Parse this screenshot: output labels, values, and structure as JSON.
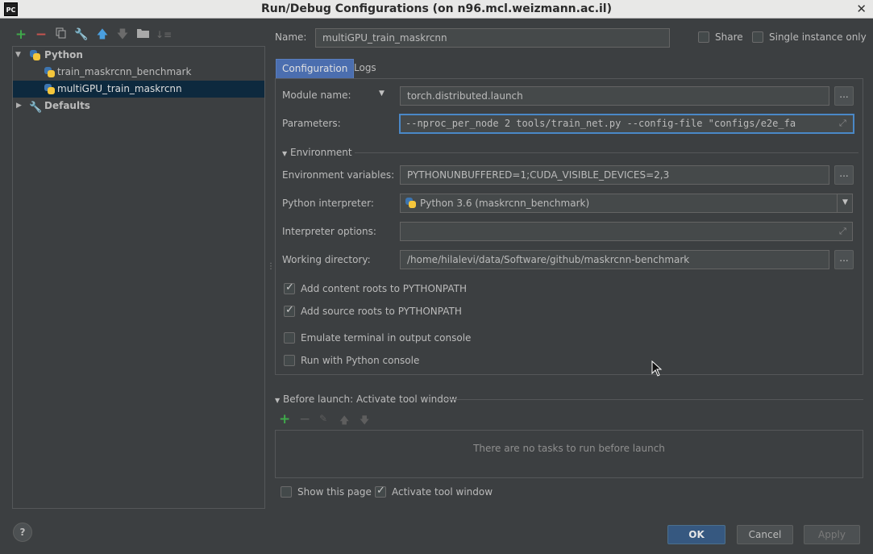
{
  "window": {
    "title": "Run/Debug Configurations (on n96.mcl.weizmann.ac.il)",
    "app_icon_text": "PC",
    "close_glyph": "✕"
  },
  "tree": {
    "toolbar": [
      "add-icon",
      "remove-icon",
      "copy-icon",
      "edit-defaults-icon",
      "move-up-icon",
      "move-down-icon",
      "folder-icon",
      "sort-icon"
    ],
    "python_label": "Python",
    "items": [
      "train_maskrcnn_benchmark",
      "multiGPU_train_maskrcnn"
    ],
    "defaults_label": "Defaults"
  },
  "name": {
    "label": "Name:",
    "value": "multiGPU_train_maskrcnn"
  },
  "share_label": "Share",
  "single_instance_label": "Single instance only",
  "tabs": [
    "Configuration",
    "Logs"
  ],
  "config": {
    "module_label": "Module name:",
    "module_value": "torch.distributed.launch",
    "parameters_label": "Parameters:",
    "parameters_value": "--nproc_per_node 2 tools/train_net.py --config-file \"configs/e2e_fa",
    "environment_section": "Environment",
    "env_vars_label": "Environment variables:",
    "env_vars_value": "PYTHONUNBUFFERED=1;CUDA_VISIBLE_DEVICES=2,3",
    "interpreter_label": "Python interpreter:",
    "interpreter_value": "Python 3.6 (maskrcnn_benchmark)",
    "interp_options_label": "Interpreter options:",
    "interp_options_value": "",
    "workdir_label": "Working directory:",
    "workdir_value": "/home/hilalevi/data/Software/github/maskrcnn-benchmark",
    "ellipsis": "...",
    "checks": [
      {
        "label": "Add content roots to PYTHONPATH",
        "checked": true
      },
      {
        "label": "Add source roots to PYTHONPATH",
        "checked": true
      },
      {
        "label": "Emulate terminal in output console",
        "checked": false
      },
      {
        "label": "Run with Python console",
        "checked": false
      }
    ]
  },
  "before_launch": {
    "title": "Before launch: Activate tool window",
    "empty_text": "There are no tasks to run before launch",
    "toolbar": [
      "add-icon",
      "remove-icon",
      "edit-icon",
      "move-up-icon",
      "move-down-icon"
    ]
  },
  "footer": {
    "show_page_label": "Show this page",
    "show_page_checked": false,
    "activate_tool_label": "Activate tool window",
    "activate_tool_checked": true,
    "ok": "OK",
    "cancel": "Cancel",
    "apply": "Apply",
    "help": "?"
  },
  "colors": {
    "background": "#3c3f41",
    "selection": "#0d293e",
    "accent": "#4a88c7",
    "add_green": "#3fa84a",
    "remove_red": "#c75450"
  }
}
